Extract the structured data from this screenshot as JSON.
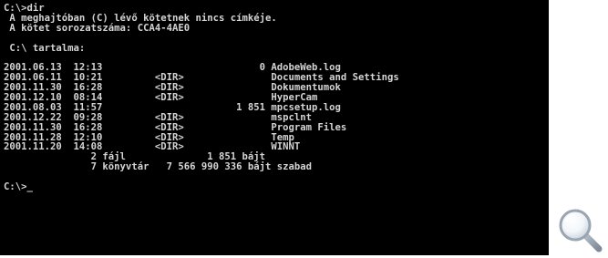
{
  "console": {
    "lines": [
      "C:\\>dir",
      " A meghajtóban (C) lévő kötetnek nincs címkéje.",
      " A kötet sorozatszáma: CCA4-4AE0",
      "",
      " C:\\ tartalma:",
      ""
    ],
    "entries": [
      {
        "date": "2001.06.13",
        "time": "12:13",
        "dir": "",
        "size": "0",
        "name": "AdobeWeb.log"
      },
      {
        "date": "2001.06.11",
        "time": "10:21",
        "dir": "<DIR>",
        "size": "",
        "name": "Documents and Settings"
      },
      {
        "date": "2001.11.30",
        "time": "16:28",
        "dir": "<DIR>",
        "size": "",
        "name": "Dokumentumok"
      },
      {
        "date": "2001.12.10",
        "time": "08:14",
        "dir": "<DIR>",
        "size": "",
        "name": "HyperCam"
      },
      {
        "date": "2001.08.03",
        "time": "11:57",
        "dir": "",
        "size": "1 851",
        "name": "mpcsetup.log"
      },
      {
        "date": "2001.12.22",
        "time": "09:28",
        "dir": "<DIR>",
        "size": "",
        "name": "mspclnt"
      },
      {
        "date": "2001.11.30",
        "time": "16:28",
        "dir": "<DIR>",
        "size": "",
        "name": "Program Files"
      },
      {
        "date": "2001.11.28",
        "time": "12:10",
        "dir": "<DIR>",
        "size": "",
        "name": "Temp"
      },
      {
        "date": "2001.11.20",
        "time": "14:08",
        "dir": "<DIR>",
        "size": "",
        "name": "WINNT"
      }
    ],
    "summary": {
      "files_line": "               2 fájl              1 851 bájt",
      "dirs_line": "               7 könyvtár   7 566 990 336 bájt szabad"
    },
    "prompt": "C:\\>_"
  },
  "zoom": {
    "icon": "magnifier-icon"
  }
}
